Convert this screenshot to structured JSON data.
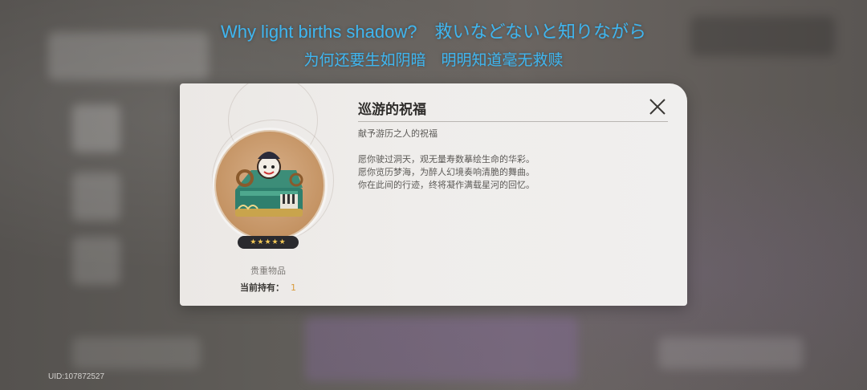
{
  "subtitles": {
    "line1": "Why light births shadow?　救いなどないと知りながら",
    "line2": "为何还要生如阴暗　明明知道毫无救赎"
  },
  "uid": "UID:107872527",
  "item": {
    "title": "巡游的祝福",
    "subhead": "献予游历之人的祝福",
    "description": [
      "愿你驶过洞天，观无量寿数摹绘生命的华彩。",
      "愿你览历梦海，为醉人幻境奏响清脆的舞曲。",
      "你在此间的行迹，终将凝作满载星河的回忆。"
    ],
    "rarity_stars": "★★★★★",
    "type": "贵重物品",
    "owned_label": "当前持有：",
    "owned_value": "1"
  },
  "icons": {
    "close": "close-icon",
    "item": "treasure-chest-icon"
  },
  "colors": {
    "subtitle": "#3fb6f0",
    "owned_value": "#d99b3c",
    "rarity": "#f0c656"
  }
}
